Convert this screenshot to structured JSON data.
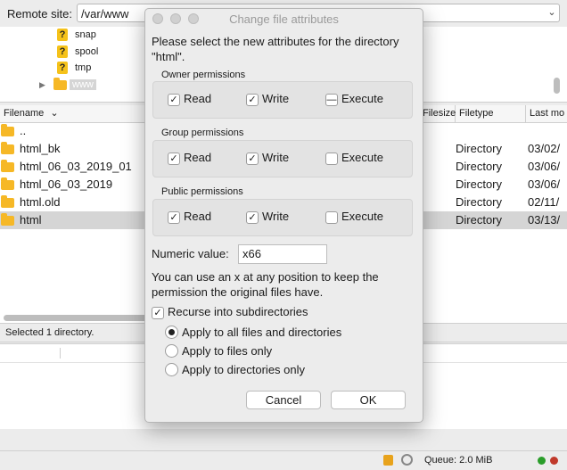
{
  "remote": {
    "label": "Remote site:",
    "path": "/var/www",
    "dropdown_icon": "chevron-down-icon"
  },
  "tree": {
    "items": [
      "snap",
      "spool",
      "tmp",
      "www"
    ]
  },
  "filelist": {
    "columns": [
      "Filename",
      "Filesize",
      "Filetype",
      "Last mo"
    ],
    "rows": [
      {
        "name": "..",
        "type": "",
        "date": ""
      },
      {
        "name": "html_bk",
        "type": "Directory",
        "date": "03/02/"
      },
      {
        "name": "html_06_03_2019_01",
        "type": "Directory",
        "date": "03/06/"
      },
      {
        "name": "html_06_03_2019",
        "type": "Directory",
        "date": "03/06/"
      },
      {
        "name": "html.old",
        "type": "Directory",
        "date": "02/11/"
      },
      {
        "name": "html",
        "type": "Directory",
        "date": "03/13/",
        "selected": true
      }
    ],
    "status": "Selected 1 directory."
  },
  "bottom": {
    "queue": "Queue: 2.0 MiB"
  },
  "dialog": {
    "title": "Change file attributes",
    "intro": "Please select the new attributes for the directory \"html\".",
    "groups": [
      {
        "label": "Owner permissions",
        "read": "Read",
        "write": "Write",
        "execute": "Execute",
        "read_state": "checked",
        "write_state": "checked",
        "execute_state": "mixed"
      },
      {
        "label": "Group permissions",
        "read": "Read",
        "write": "Write",
        "execute": "Execute",
        "read_state": "checked",
        "write_state": "checked",
        "execute_state": "unchecked"
      },
      {
        "label": "Public permissions",
        "read": "Read",
        "write": "Write",
        "execute": "Execute",
        "read_state": "checked",
        "write_state": "checked",
        "execute_state": "unchecked"
      }
    ],
    "numeric_label": "Numeric value:",
    "numeric_value": "x66",
    "help": "You can use an x at any position to keep the permission the original files have.",
    "recurse_label": "Recurse into subdirectories",
    "recurse_checked": true,
    "options": [
      {
        "label": "Apply to all files and directories",
        "selected": true
      },
      {
        "label": "Apply to files only",
        "selected": false
      },
      {
        "label": "Apply to directories only",
        "selected": false
      }
    ],
    "cancel": "Cancel",
    "ok": "OK"
  }
}
